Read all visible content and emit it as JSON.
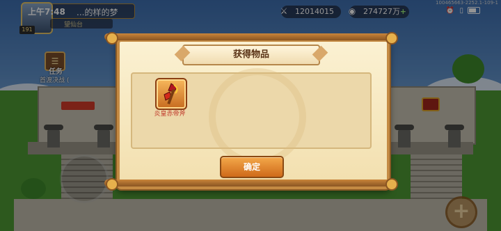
{
  "status_bar": {
    "time": "上午7:48",
    "build": "100465663-2252.1-109-1",
    "icons": [
      "alarm-icon",
      "nfc-icon",
      "wifi-icon",
      "battery-icon"
    ]
  },
  "player": {
    "name": "...的样的梦",
    "level": "191",
    "vip": "望仙台"
  },
  "resources": [
    {
      "icon": "crossed-swords-icon",
      "value": "12014015"
    },
    {
      "icon": "coin-icon",
      "value": "274727万"
    }
  ],
  "task": {
    "label": "任务",
    "description": "首渡决战 ("
  },
  "dialog": {
    "title": "获得物品",
    "item": {
      "name": "炎皇赤帝斧",
      "icon": "flame-axe-icon"
    },
    "confirm_label": "确定"
  },
  "colors": {
    "dialog_bg": "#f2dfae",
    "border": "#c48a43",
    "button": "#cf6a1a",
    "item_name": "#c0392b"
  }
}
